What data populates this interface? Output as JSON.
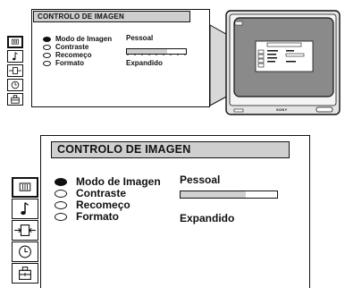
{
  "menu": {
    "title": "CONTROLO DE IMAGEN",
    "icons": [
      {
        "name": "picture-menu-icon",
        "selected": true
      },
      {
        "name": "sound-icon",
        "selected": false
      },
      {
        "name": "screen-adjust-icon",
        "selected": false
      },
      {
        "name": "timer-icon",
        "selected": false
      },
      {
        "name": "setup-icon",
        "selected": false
      }
    ],
    "items": [
      {
        "label": "Modo de Imagen",
        "selected": true
      },
      {
        "label": "Contraste",
        "selected": false
      },
      {
        "label": "Recomeço",
        "selected": false
      },
      {
        "label": "Formato",
        "selected": false
      }
    ],
    "values": {
      "mode": "Pessoal",
      "format": "Expandido"
    },
    "contrast_level": 0.68
  },
  "tv": {
    "brand": "SONY"
  },
  "colors": {
    "title_bg": "#cfcfcf",
    "bar_fill": "#d0d0d0",
    "tv_body": "#e4e4e4",
    "screen": "#8a8a8a"
  }
}
